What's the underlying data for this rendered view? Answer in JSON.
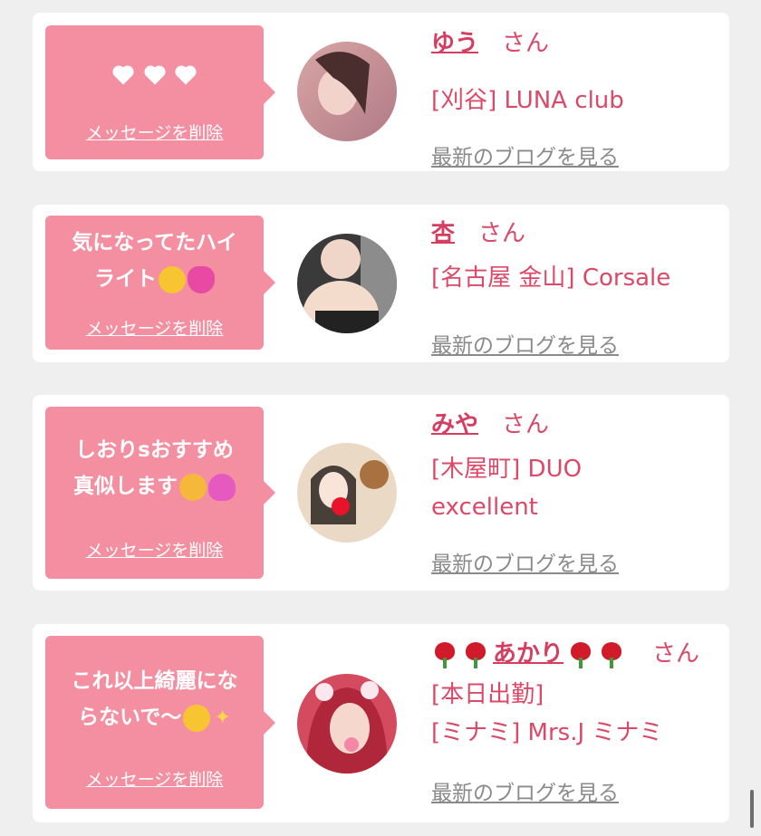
{
  "delete_label": "メッセージを削除",
  "san_label": "さん",
  "blog_label": "最新のブログを見る",
  "items": [
    {
      "message_line1": "",
      "message_line2": "",
      "name": "ゆう",
      "shop": "[刈谷] LUNA club"
    },
    {
      "message_line1": "気になってたハイ",
      "message_line2": "ライト",
      "name": "杏",
      "shop": "[名古屋 金山] Corsale"
    },
    {
      "message_line1": "しおりsおすすめ",
      "message_line2": "真似します",
      "name": "みや",
      "shop": "[木屋町] DUO excellent"
    },
    {
      "message_line1": "これ以上綺麗にな",
      "message_line2": "らないで〜",
      "name": "あかり",
      "name_suffix_line": "さん",
      "status": "[本日出勤]",
      "shop": "[ミナミ] Mrs.J ミナミ"
    }
  ],
  "colors": {
    "bubble": "#f48fa1",
    "accent": "#dc4968",
    "link_gray": "#8a8a8a"
  },
  "icons": [
    "heart-icon",
    "smiling-emoji",
    "hearts-emoji",
    "party-face-emoji",
    "heart-eyes-emoji",
    "sparkles-emoji",
    "rose-icon"
  ]
}
